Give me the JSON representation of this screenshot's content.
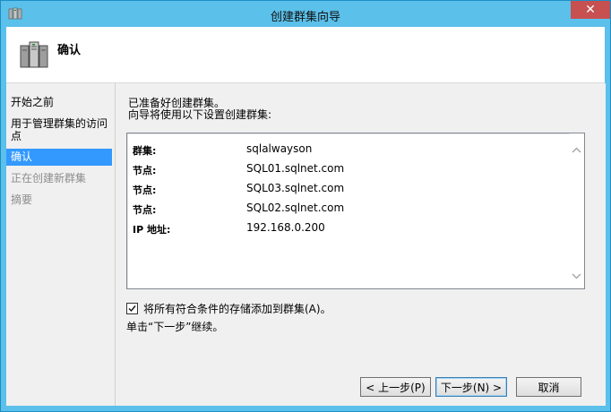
{
  "window": {
    "title": "创建群集向导",
    "close_label": "✕"
  },
  "header": {
    "title": "确认"
  },
  "nav": {
    "items": [
      {
        "label": "开始之前",
        "state": "normal"
      },
      {
        "label": "用于管理群集的访问点",
        "state": "normal"
      },
      {
        "label": "确认",
        "state": "selected"
      },
      {
        "label": "正在创建新群集",
        "state": "disabled"
      },
      {
        "label": "摘要",
        "state": "disabled"
      }
    ]
  },
  "main": {
    "intro_line1": "已准备好创建群集。",
    "intro_line2": "向导将使用以下设置创建群集:",
    "settings": [
      {
        "key": "群集:",
        "value": "sqlalwayson"
      },
      {
        "key": "节点:",
        "value": "SQL01.sqlnet.com"
      },
      {
        "key": "节点:",
        "value": "SQL03.sqlnet.com"
      },
      {
        "key": "节点:",
        "value": "SQL02.sqlnet.com"
      },
      {
        "key": "IP 地址:",
        "value": "192.168.0.200"
      }
    ],
    "checkbox_label": "将所有符合条件的存储添加到群集(A)。",
    "checkbox_checked": true,
    "note": "单击“下一步”继续。"
  },
  "buttons": {
    "prev": "< 上一步(P)",
    "next": "下一步(N) >",
    "cancel": "取消"
  },
  "colors": {
    "titlebar": "#5bc0ea",
    "selected_nav": "#3399ff",
    "close_button": "#c75050"
  }
}
